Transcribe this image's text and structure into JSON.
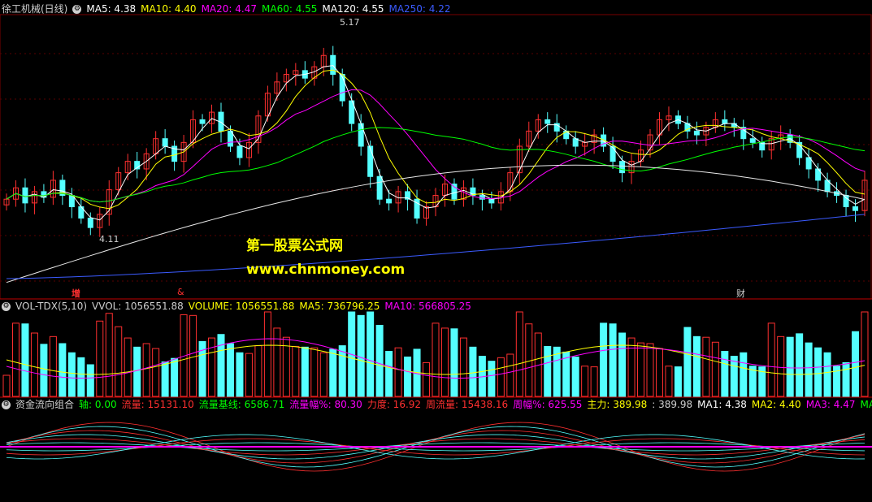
{
  "stock": {
    "name": "徐工机械(日线)"
  },
  "price_panel": {
    "legend": [
      {
        "label": "MA5: 4.38",
        "color": "#ffffff"
      },
      {
        "label": "MA10: 4.40",
        "color": "#ffff00"
      },
      {
        "label": "MA20: 4.47",
        "color": "#ff00ff"
      },
      {
        "label": "MA60: 4.55",
        "color": "#00ff00"
      },
      {
        "label": "MA120: 4.55",
        "color": "#ffffff"
      },
      {
        "label": "MA250: 4.22",
        "color": "#3b5bff"
      }
    ],
    "high_label": "5.17",
    "low_label": "4.11",
    "markers": [
      {
        "text": "增",
        "color": "#ff3030"
      },
      {
        "text": "&",
        "color": "#ff3030"
      },
      {
        "text": "财",
        "color": "#cfcfcf"
      }
    ]
  },
  "volume_panel": {
    "legend": [
      {
        "label": "VOL-TDX(5,10)",
        "color": "#cfcfcf"
      },
      {
        "label": "VVOL: 1056551.88",
        "color": "#cfcfcf"
      },
      {
        "label": "VOLUME: 1056551.88",
        "color": "#ffff00"
      },
      {
        "label": "MA5: 736796.25",
        "color": "#ffff00"
      },
      {
        "label": "MA10: 566805.25",
        "color": "#ff00ff"
      }
    ]
  },
  "flow_panel": {
    "legend": [
      {
        "label": "资金流向组合",
        "color": "#cfcfcf"
      },
      {
        "label": "轴: 0.00",
        "color": "#00ff00"
      },
      {
        "label": "流量: 15131.10",
        "color": "#ff3030"
      },
      {
        "label": "流量基线: 6586.71",
        "color": "#00ff00"
      },
      {
        "label": "流量幅%: 80.30",
        "color": "#ff00ff"
      },
      {
        "label": "力度: 16.92",
        "color": "#ff3030"
      },
      {
        "label": "周流量: 15438.16",
        "color": "#ff3030"
      },
      {
        "label": "周幅%: 625.55",
        "color": "#ff00ff"
      },
      {
        "label": "主力: 389.98",
        "color": "#ffff00"
      },
      {
        "label": ": 389.98",
        "color": "#cfcfcf"
      },
      {
        "label": "MA1: 4.38",
        "color": "#ffffff"
      },
      {
        "label": "MA2: 4.40",
        "color": "#ffff00"
      },
      {
        "label": "MA3: 4.47",
        "color": "#ff00ff"
      },
      {
        "label": "MA4: 4.55",
        "color": "#00ff00"
      }
    ]
  },
  "watermark": {
    "line1": "第一股票公式网",
    "line2": "www.chnmoney.com"
  },
  "chart_data": {
    "type": "candlestick",
    "closes": [
      4.3,
      4.36,
      4.28,
      4.34,
      4.31,
      4.4,
      4.32,
      4.26,
      4.2,
      4.15,
      4.22,
      4.35,
      4.44,
      4.5,
      4.46,
      4.54,
      4.62,
      4.58,
      4.5,
      4.6,
      4.72,
      4.7,
      4.76,
      4.66,
      4.58,
      4.52,
      4.6,
      4.74,
      4.86,
      4.92,
      4.96,
      4.98,
      4.94,
      5.0,
      5.06,
      4.96,
      4.82,
      4.7,
      4.58,
      4.42,
      4.3,
      4.28,
      4.34,
      4.3,
      4.2,
      4.26,
      4.32,
      4.38,
      4.3,
      4.36,
      4.32,
      4.3,
      4.28,
      4.34,
      4.44,
      4.58,
      4.66,
      4.72,
      4.7,
      4.66,
      4.62,
      4.58,
      4.6,
      4.64,
      4.58,
      4.5,
      4.44,
      4.5,
      4.56,
      4.64,
      4.72,
      4.74,
      4.7,
      4.66,
      4.64,
      4.68,
      4.72,
      4.7,
      4.68,
      4.62,
      4.6,
      4.56,
      4.62,
      4.64,
      4.6,
      4.52,
      4.46,
      4.4,
      4.34,
      4.32,
      4.26,
      4.24,
      4.4
    ],
    "ma250_start": 3.88,
    "ma250_end": 4.22,
    "volume_range": [
      0,
      1200000
    ],
    "flow_range": [
      -1,
      1
    ]
  }
}
